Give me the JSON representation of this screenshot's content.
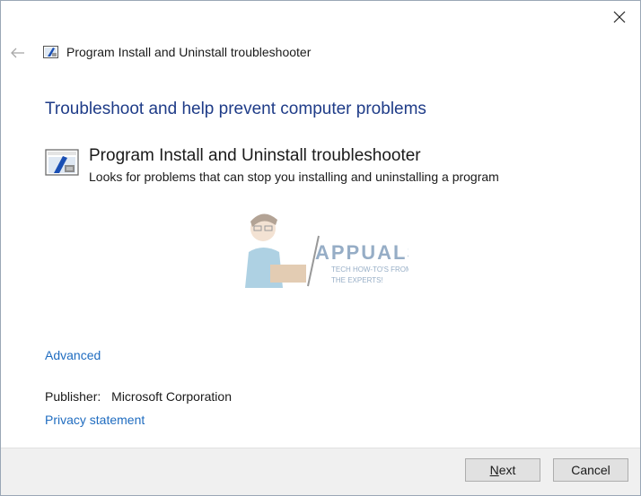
{
  "window": {
    "title": "Program Install and Uninstall troubleshooter",
    "close_label": "×"
  },
  "content": {
    "heading": "Troubleshoot and help prevent computer problems",
    "troubleshooter": {
      "name": "Program Install and Uninstall troubleshooter",
      "description": "Looks for problems that can stop you installing and uninstalling a program"
    },
    "advanced_link": "Advanced",
    "publisher_label": "Publisher:",
    "publisher_value": "Microsoft Corporation",
    "privacy_link": "Privacy statement"
  },
  "watermark": {
    "brand": "APPUALS",
    "tagline_1": "TECH HOW-TO'S FROM",
    "tagline_2": "THE EXPERTS!"
  },
  "footer": {
    "next_mnemonic": "N",
    "next_rest": "ext",
    "cancel_label": "Cancel"
  },
  "colors": {
    "heading": "#1f3c88",
    "link": "#1f6cc0",
    "footer_bg": "#f0f0f0"
  }
}
